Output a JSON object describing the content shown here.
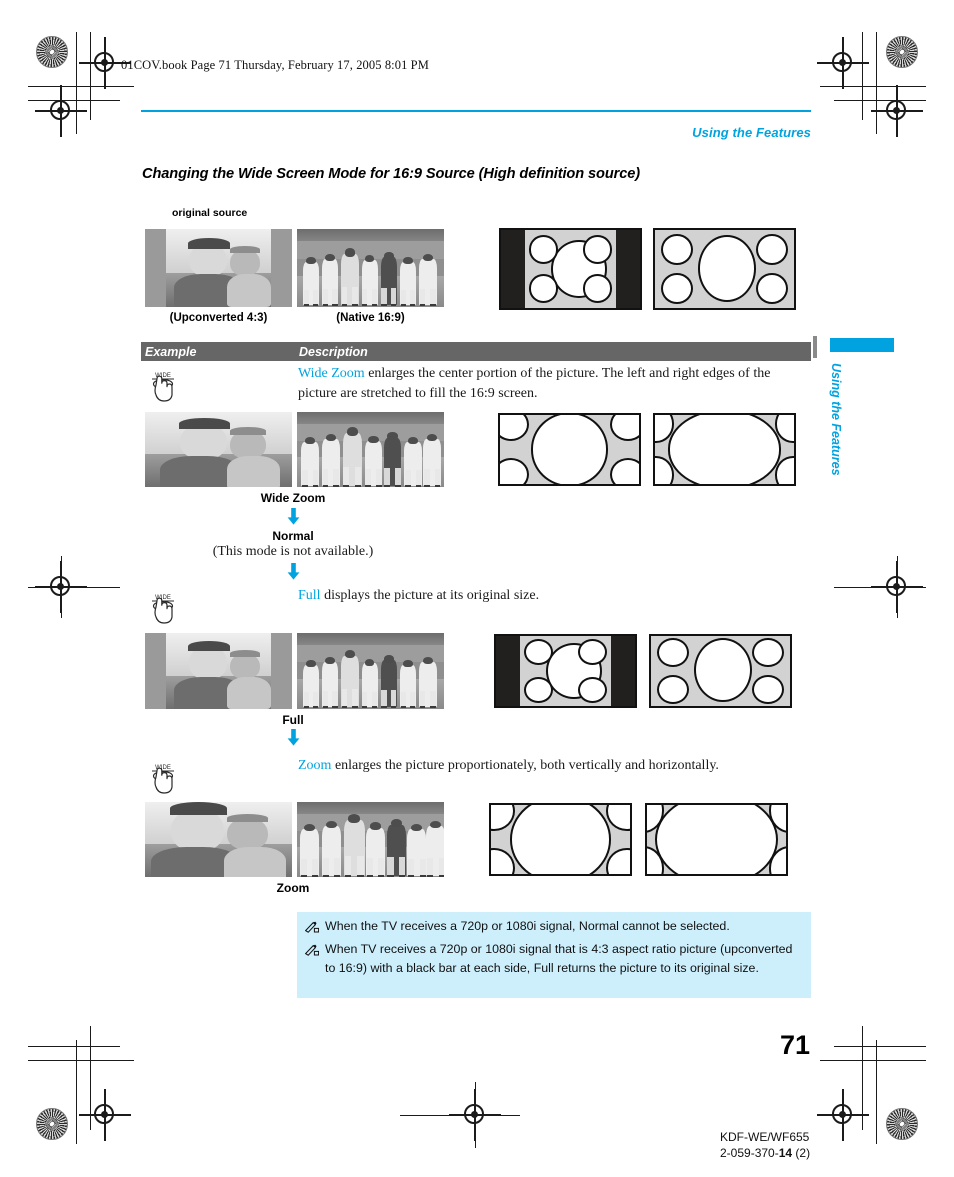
{
  "page": {
    "book_line": "01COV.book  Page 71  Thursday, February 17, 2005  8:01 PM",
    "running_head": "Using the Features",
    "section_title": "Changing the Wide Screen Mode for 16:9 Source (High definition source)",
    "page_number": "71",
    "footer_model": "KDF-WE/WF655",
    "footer_partnumber_prefix": "2-059-370-",
    "footer_partnumber_bold": "14",
    "footer_partnumber_suffix": " (2)",
    "thumb_tab": "Using the Features",
    "accent_color": "#00a3e0",
    "header_bar_color": "#666666",
    "note_box_color": "#cdeffc"
  },
  "original_source": {
    "label": "original source",
    "captions": [
      "(Upconverted 4:3)",
      "(Native 16:9)"
    ]
  },
  "table": {
    "columns": [
      "Example",
      "Description"
    ]
  },
  "modes": [
    {
      "icon": "wide-button-icon",
      "keyword": "Wide Zoom",
      "description_rest": " enlarges the center portion of the picture. The left and right edges of the picture are stretched to fill the 16:9 screen.",
      "label": "Wide Zoom"
    },
    {
      "label": "Normal",
      "note": "(This mode is not available.)"
    },
    {
      "icon": "wide-button-icon",
      "keyword": "Full",
      "description_rest": " displays the picture at its original size.",
      "label": "Full"
    },
    {
      "icon": "wide-button-icon",
      "keyword": "Zoom",
      "description_rest": " enlarges the picture proportionately, both vertically and horizontally.",
      "label": "Zoom"
    }
  ],
  "notes": [
    "When the TV receives a 720p or 1080i signal, Normal cannot be selected.",
    "When TV receives a 720p or 1080i signal that is 4:3 aspect ratio picture (upconverted to 16:9) with a black bar at each side, Full returns the picture to its original size."
  ]
}
